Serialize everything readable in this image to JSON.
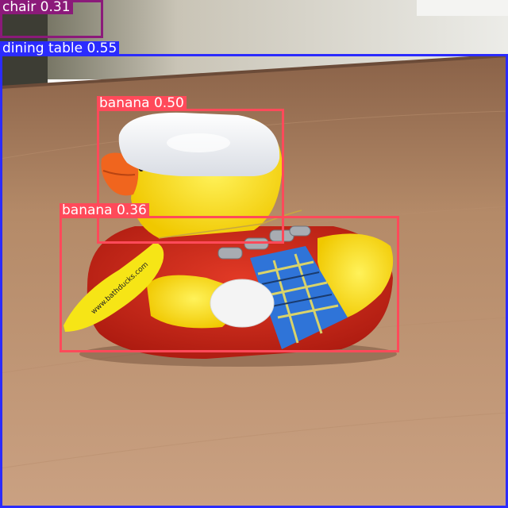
{
  "colors": {
    "chair": "#8b1a7a",
    "dining_table": "#2b2bff",
    "banana": "#ff4a5a"
  },
  "detections": [
    {
      "name": "chair",
      "label": "chair 0.31",
      "color": "#8b1a7a"
    },
    {
      "name": "dining table",
      "label": "dining table 0.55",
      "color": "#2b2bff"
    },
    {
      "name": "banana",
      "label": "banana 0.50",
      "color": "#ff4a5a"
    },
    {
      "name": "banana",
      "label": "banana 0.36",
      "color": "#ff4a5a"
    }
  ],
  "tag": {
    "text": "www.bathducks.com"
  }
}
